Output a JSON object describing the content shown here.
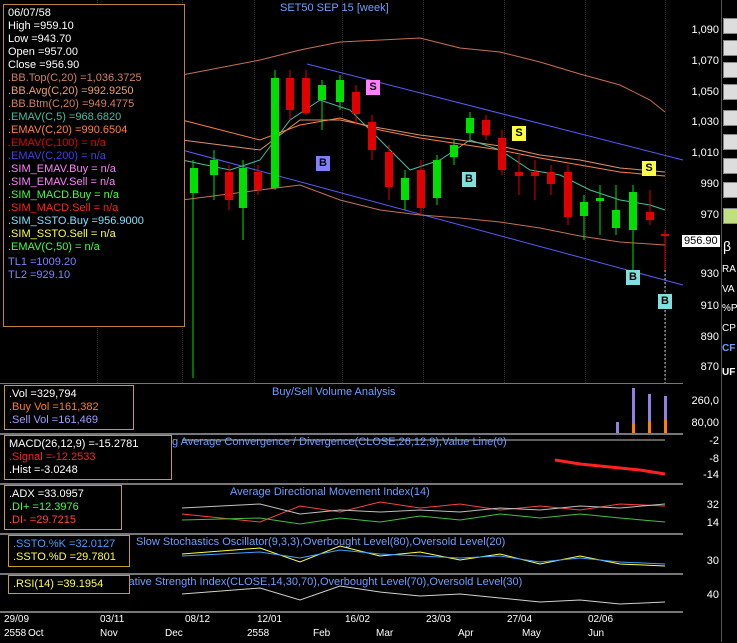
{
  "main": {
    "title": "SET50 SEP 15  [week]",
    "last_price": "956.90",
    "price_ticks": [
      "1,090",
      "1,070",
      "1,050",
      "1,030",
      "1,010",
      "990",
      "970",
      "950",
      "930",
      "910",
      "890",
      "870"
    ],
    "info": {
      "date": "06/07/58",
      "high": "High  =959.10",
      "low": "Low   =943.70",
      "open": "Open  =957.00",
      "close": "Close  =956.90",
      "bbtop": ".BB.Top(C,20)  =1,036.3725",
      "bbavg": ".BB.Avg(C,20)  =992.9250",
      "bbbtm": ".BB.Btm(C,20)  =949.4775",
      "emav5": ".EMAV(C,5)  =968.6820",
      "emav20": ".EMAV(C,20)  =990.6504",
      "emav100": ".EMAV(C,100)  = n/a",
      "emav200": ".EMAV(C,200)  = n/a",
      "sim_emav_buy": ".SIM_EMAV.Buy  = n/a",
      "sim_emav_sell": ".SIM_EMAV.Sell  = n/a",
      "sim_macd_buy": ".SIM_MACD.Buy  = n/a",
      "sim_macd_sell": ".SIM_MACD.Sell  = n/a",
      "sim_ssto_buy": ".SIM_SSTO.Buy  =956.9000",
      "sim_ssto_sell": ".SIM_SSTO.Sell  = n/a",
      "emav50": ".EMAV(C,50)  = n/a",
      "tl1": "TL1 =1009.20",
      "tl2": "TL2 =929.10"
    },
    "markers": {
      "buy": "B",
      "sell": "S"
    }
  },
  "volume": {
    "title": "Buy/Sell Volume Analysis",
    "vol": ".Vol   =329,794",
    "buy": ".Buy Vol  =161,382",
    "sell": ".Sell Vol  =161,469",
    "ticks": [
      "260,0",
      "80,00"
    ]
  },
  "macd": {
    "title": "g Average Convergence / Divergence(CLOSE,26,12,9),Value Line(0)",
    "macd": "MACD(26,12,9)  =-15.2781",
    "signal": ".Signal  =-12.2533",
    "hist": ".Hist =-3.0248",
    "ticks": [
      "-2",
      "-8",
      "-14"
    ]
  },
  "adx": {
    "title": "Average Directional Movement Index(14)",
    "adx": ".ADX  =33.0957",
    "diplus": ".DI+  =12.3976",
    "diminus": ".DI-   =29.7215",
    "ticks": [
      "32",
      "14"
    ]
  },
  "ssto": {
    "title": "Slow Stochastics Oscillator(9,3,3),Overbought Level(80),Oversold Level(20)",
    "k": ".SSTO.%K  =32.0127",
    "d": ".SSTO.%D  =29.7801",
    "ticks": [
      "30"
    ]
  },
  "rsi": {
    "title": "elative Strength Index(CLOSE,14,30,70),Overbought Level(70),Oversold Level(30)",
    "rsi": ".RSI(14)  =39.1954",
    "ticks": [
      "40"
    ]
  },
  "xaxis": {
    "dates": [
      "29/09",
      "03/11",
      "08/12",
      "12/01",
      "16/02",
      "23/03",
      "27/04",
      "02/06"
    ],
    "months": [
      "2558",
      "Oct",
      "Nov",
      "Dec",
      "2558",
      "Feb",
      "Mar",
      "Apr",
      "May",
      "Jun"
    ]
  },
  "right_toolbar": [
    "β",
    "RA",
    "VA",
    "%P",
    "CP",
    "CF",
    "UF"
  ],
  "colors": {
    "bull": "#00e000",
    "bear": "#e00000",
    "bb": "#c87050",
    "trend": "#5a5aff",
    "ema5": "#40c0a0",
    "ema20": "#ff8040"
  }
}
